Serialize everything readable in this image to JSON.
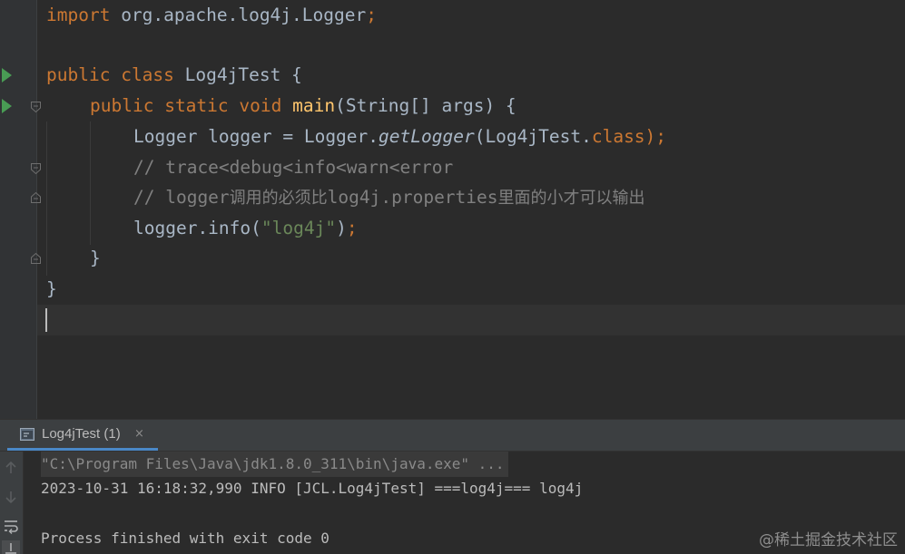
{
  "editor": {
    "lines": {
      "l1": {
        "kw_import": "import",
        "pkg": " org.apache.log4j.Logger",
        "semi": ";"
      },
      "l3": {
        "kw_public": "public",
        "kw_class": "class",
        "class_name": " Log4jTest {"
      },
      "l4": {
        "kw_public": "public",
        "kw_static": "static",
        "kw_void": "void",
        "method": "main",
        "params": "(String[] args) {"
      },
      "l5": {
        "decl": "Logger logger = Logger.",
        "call": "getLogger",
        "arg": "(Log4jTest.",
        "kw_class": "class",
        "end": ");"
      },
      "l6": {
        "comment": "// trace<debug<info<warn<error"
      },
      "l7": {
        "comment_prefix": "// logger",
        "comment_cjk": "调用的必须比",
        "comment_mid": "log4j.properties",
        "comment_cjk2": "里面的小才可以输出"
      },
      "l8": {
        "call": "logger.info(",
        "string": "\"log4j\"",
        "close": ")",
        "semi": ";"
      },
      "l9": {
        "brace": "}"
      },
      "l10": {
        "brace": "}"
      }
    }
  },
  "run_panel": {
    "tab": {
      "label": "Log4jTest (1)",
      "close": "×"
    },
    "console": {
      "command": "\"C:\\Program Files\\Java\\jdk1.8.0_311\\bin\\java.exe\" ...",
      "log": "2023-10-31 16:18:32,990 INFO [JCL.Log4jTest] ===log4j=== log4j",
      "exit": "Process finished with exit code 0"
    }
  },
  "watermark": "@稀土掘金技术社区",
  "icons": {
    "run_markers": [
      "play-icon",
      "play-icon"
    ],
    "fold_markers": [
      "fold-open-icon",
      "fold-open-icon",
      "fold-close-icon",
      "fold-close-icon"
    ],
    "toolbar": [
      "arrow-up-icon",
      "arrow-down-icon",
      "soft-wrap-icon",
      "scroll-to-end-icon"
    ]
  },
  "colors": {
    "background": "#2b2b2b",
    "keyword": "#cc7832",
    "method": "#ffc66d",
    "string": "#6a8759",
    "comment": "#808080",
    "text": "#a9b7c6",
    "run_green": "#499c54",
    "tab_underline": "#4a88c7"
  }
}
